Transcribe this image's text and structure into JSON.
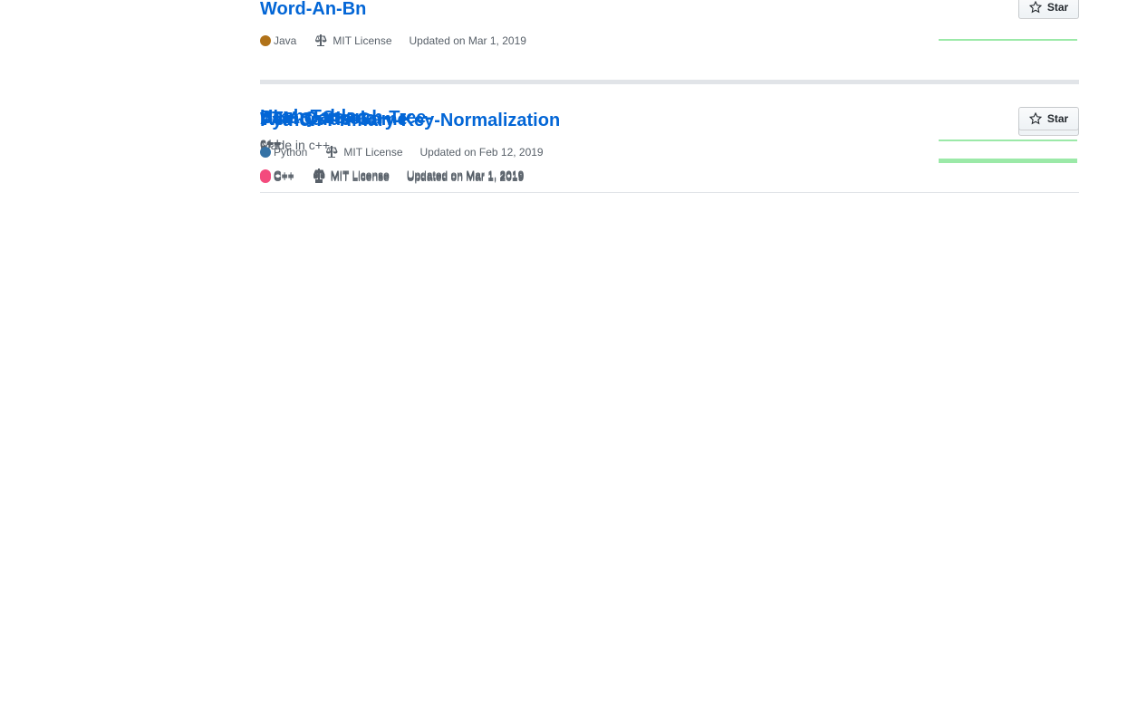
{
  "star_label": "Star",
  "repos": [
    {
      "name": "Word-An-Bn",
      "description": "",
      "language": "Java",
      "language_color": "#b07219",
      "license": "MIT License",
      "updated": "Updated on Mar 1, 2019"
    },
    {
      "name": "Hash-Table",
      "description": "c++",
      "language": "C++",
      "language_color": "#f34b7d",
      "license": "MIT License",
      "updated": "Updated on Mar 1, 2019"
    },
    {
      "name": "Binary-Search-Tree-",
      "description": "c++",
      "language": "C++",
      "language_color": "#f34b7d",
      "license": "MIT License",
      "updated": "Updated on Mar 1, 2019"
    },
    {
      "name": "ATM-Console",
      "description": "c++",
      "language": "C++",
      "language_color": "#f34b7d",
      "license": "MIT License",
      "updated": "Updated on Mar 1, 2019"
    },
    {
      "name": "War-Cards-Game",
      "description": "Made in c++",
      "language": "C++",
      "language_color": "#f34b7d",
      "license": "MIT License",
      "updated": "Updated on Mar 1, 2019"
    },
    {
      "name": "Python-Primary-Key-Normalization",
      "description": "",
      "language": "Python",
      "language_color": "#3572A5",
      "license": "MIT License",
      "updated": "Updated on Feb 12, 2019"
    }
  ]
}
